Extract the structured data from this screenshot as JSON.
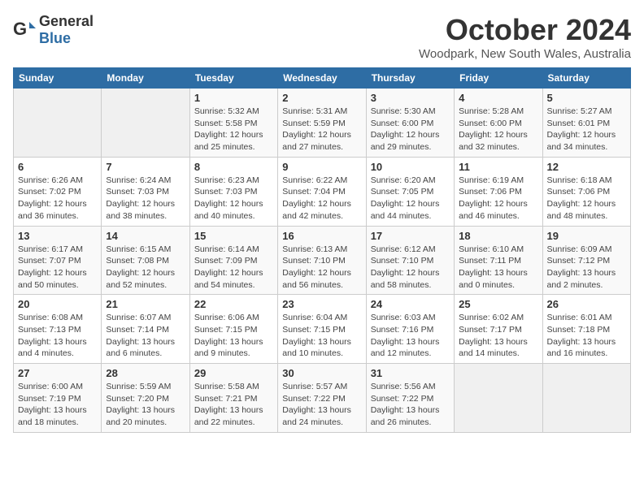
{
  "logo": {
    "text_general": "General",
    "text_blue": "Blue"
  },
  "title": "October 2024",
  "location": "Woodpark, New South Wales, Australia",
  "days_of_week": [
    "Sunday",
    "Monday",
    "Tuesday",
    "Wednesday",
    "Thursday",
    "Friday",
    "Saturday"
  ],
  "weeks": [
    [
      {
        "day": "",
        "info": ""
      },
      {
        "day": "",
        "info": ""
      },
      {
        "day": "1",
        "info": "Sunrise: 5:32 AM\nSunset: 5:58 PM\nDaylight: 12 hours\nand 25 minutes."
      },
      {
        "day": "2",
        "info": "Sunrise: 5:31 AM\nSunset: 5:59 PM\nDaylight: 12 hours\nand 27 minutes."
      },
      {
        "day": "3",
        "info": "Sunrise: 5:30 AM\nSunset: 6:00 PM\nDaylight: 12 hours\nand 29 minutes."
      },
      {
        "day": "4",
        "info": "Sunrise: 5:28 AM\nSunset: 6:00 PM\nDaylight: 12 hours\nand 32 minutes."
      },
      {
        "day": "5",
        "info": "Sunrise: 5:27 AM\nSunset: 6:01 PM\nDaylight: 12 hours\nand 34 minutes."
      }
    ],
    [
      {
        "day": "6",
        "info": "Sunrise: 6:26 AM\nSunset: 7:02 PM\nDaylight: 12 hours\nand 36 minutes."
      },
      {
        "day": "7",
        "info": "Sunrise: 6:24 AM\nSunset: 7:03 PM\nDaylight: 12 hours\nand 38 minutes."
      },
      {
        "day": "8",
        "info": "Sunrise: 6:23 AM\nSunset: 7:03 PM\nDaylight: 12 hours\nand 40 minutes."
      },
      {
        "day": "9",
        "info": "Sunrise: 6:22 AM\nSunset: 7:04 PM\nDaylight: 12 hours\nand 42 minutes."
      },
      {
        "day": "10",
        "info": "Sunrise: 6:20 AM\nSunset: 7:05 PM\nDaylight: 12 hours\nand 44 minutes."
      },
      {
        "day": "11",
        "info": "Sunrise: 6:19 AM\nSunset: 7:06 PM\nDaylight: 12 hours\nand 46 minutes."
      },
      {
        "day": "12",
        "info": "Sunrise: 6:18 AM\nSunset: 7:06 PM\nDaylight: 12 hours\nand 48 minutes."
      }
    ],
    [
      {
        "day": "13",
        "info": "Sunrise: 6:17 AM\nSunset: 7:07 PM\nDaylight: 12 hours\nand 50 minutes."
      },
      {
        "day": "14",
        "info": "Sunrise: 6:15 AM\nSunset: 7:08 PM\nDaylight: 12 hours\nand 52 minutes."
      },
      {
        "day": "15",
        "info": "Sunrise: 6:14 AM\nSunset: 7:09 PM\nDaylight: 12 hours\nand 54 minutes."
      },
      {
        "day": "16",
        "info": "Sunrise: 6:13 AM\nSunset: 7:10 PM\nDaylight: 12 hours\nand 56 minutes."
      },
      {
        "day": "17",
        "info": "Sunrise: 6:12 AM\nSunset: 7:10 PM\nDaylight: 12 hours\nand 58 minutes."
      },
      {
        "day": "18",
        "info": "Sunrise: 6:10 AM\nSunset: 7:11 PM\nDaylight: 13 hours\nand 0 minutes."
      },
      {
        "day": "19",
        "info": "Sunrise: 6:09 AM\nSunset: 7:12 PM\nDaylight: 13 hours\nand 2 minutes."
      }
    ],
    [
      {
        "day": "20",
        "info": "Sunrise: 6:08 AM\nSunset: 7:13 PM\nDaylight: 13 hours\nand 4 minutes."
      },
      {
        "day": "21",
        "info": "Sunrise: 6:07 AM\nSunset: 7:14 PM\nDaylight: 13 hours\nand 6 minutes."
      },
      {
        "day": "22",
        "info": "Sunrise: 6:06 AM\nSunset: 7:15 PM\nDaylight: 13 hours\nand 9 minutes."
      },
      {
        "day": "23",
        "info": "Sunrise: 6:04 AM\nSunset: 7:15 PM\nDaylight: 13 hours\nand 10 minutes."
      },
      {
        "day": "24",
        "info": "Sunrise: 6:03 AM\nSunset: 7:16 PM\nDaylight: 13 hours\nand 12 minutes."
      },
      {
        "day": "25",
        "info": "Sunrise: 6:02 AM\nSunset: 7:17 PM\nDaylight: 13 hours\nand 14 minutes."
      },
      {
        "day": "26",
        "info": "Sunrise: 6:01 AM\nSunset: 7:18 PM\nDaylight: 13 hours\nand 16 minutes."
      }
    ],
    [
      {
        "day": "27",
        "info": "Sunrise: 6:00 AM\nSunset: 7:19 PM\nDaylight: 13 hours\nand 18 minutes."
      },
      {
        "day": "28",
        "info": "Sunrise: 5:59 AM\nSunset: 7:20 PM\nDaylight: 13 hours\nand 20 minutes."
      },
      {
        "day": "29",
        "info": "Sunrise: 5:58 AM\nSunset: 7:21 PM\nDaylight: 13 hours\nand 22 minutes."
      },
      {
        "day": "30",
        "info": "Sunrise: 5:57 AM\nSunset: 7:22 PM\nDaylight: 13 hours\nand 24 minutes."
      },
      {
        "day": "31",
        "info": "Sunrise: 5:56 AM\nSunset: 7:22 PM\nDaylight: 13 hours\nand 26 minutes."
      },
      {
        "day": "",
        "info": ""
      },
      {
        "day": "",
        "info": ""
      }
    ]
  ]
}
